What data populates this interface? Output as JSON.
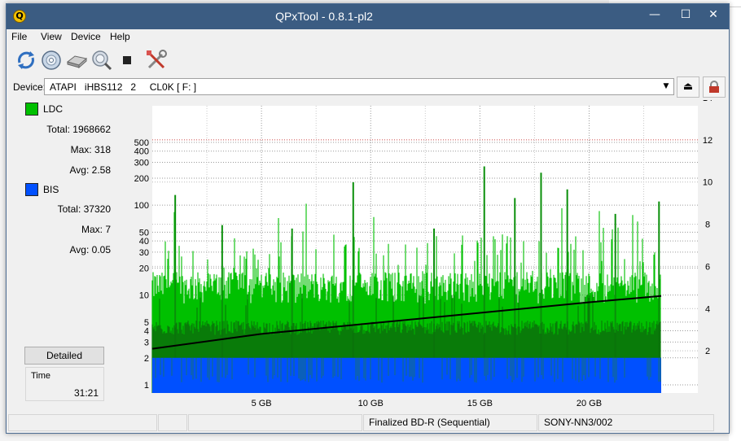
{
  "window": {
    "title": "QPxTool - 0.8.1-pl2"
  },
  "menu": {
    "items": [
      "File",
      "View",
      "Device",
      "Help"
    ]
  },
  "toolbar": {
    "tools": [
      "refresh-icon",
      "disc-info-icon",
      "drive-icon",
      "scan-icon",
      "stop-icon",
      "settings-tools-icon"
    ]
  },
  "device": {
    "label": "Device:",
    "value": "ATAPI   iHBS112   2     CL0K [ F: ]"
  },
  "ldc": {
    "name": "LDC",
    "color": "#00c000",
    "total_label": "Total: 1968662",
    "max_label": "Max: 318",
    "avg_label": "Avg: 2.58"
  },
  "bis": {
    "name": "BIS",
    "color": "#0050ff",
    "total_label": "Total: 37320",
    "max_label": "Max: 7",
    "avg_label": "Avg: 0.05"
  },
  "detailed_label": "Detailed",
  "time": {
    "label": "Time",
    "value": "31:21"
  },
  "status": {
    "disc_type": "Finalized BD-R (Sequential)",
    "media_id": "SONY-NN3/002"
  },
  "chart_data": {
    "type": "area",
    "x_axis": {
      "unit": "GB",
      "range": [
        0,
        23.3
      ],
      "ticks": [
        5,
        10,
        15,
        20
      ],
      "tick_labels": [
        "5 GB",
        "10 GB",
        "15 GB",
        "20 GB"
      ]
    },
    "y_axis_left": {
      "scale": "log",
      "range": [
        1,
        500
      ],
      "ticks": [
        1,
        2,
        3,
        4,
        5,
        10,
        20,
        30,
        40,
        50,
        100,
        200,
        300,
        400,
        500
      ]
    },
    "y_axis_right": {
      "range": [
        0,
        14
      ],
      "ticks": [
        2,
        4,
        6,
        8,
        10,
        12,
        14
      ],
      "label": ""
    },
    "grid": true,
    "series": [
      {
        "name": "LDC",
        "color": "#00c000",
        "typical_range": [
          8,
          18
        ],
        "spikes": [
          {
            "x": 1.05,
            "y": 130
          },
          {
            "x": 3.2,
            "y": 60
          },
          {
            "x": 6.4,
            "y": 55
          },
          {
            "x": 9.2,
            "y": 180
          },
          {
            "x": 12.9,
            "y": 55
          },
          {
            "x": 15.2,
            "y": 270
          },
          {
            "x": 16.6,
            "y": 120
          },
          {
            "x": 17.8,
            "y": 230
          },
          {
            "x": 19.0,
            "y": 150
          },
          {
            "x": 21.2,
            "y": 80
          },
          {
            "x": 23.2,
            "y": 110
          }
        ]
      },
      {
        "name": "BIS",
        "color": "#0050ff",
        "typical_value": 2,
        "max": 7
      },
      {
        "name": "Read speed",
        "color": "#000000",
        "axis": "right",
        "x": [
          0,
          5,
          10,
          15,
          20,
          23.3
        ],
        "y": [
          2.1,
          2.8,
          3.3,
          3.8,
          4.3,
          4.6
        ]
      }
    ]
  }
}
